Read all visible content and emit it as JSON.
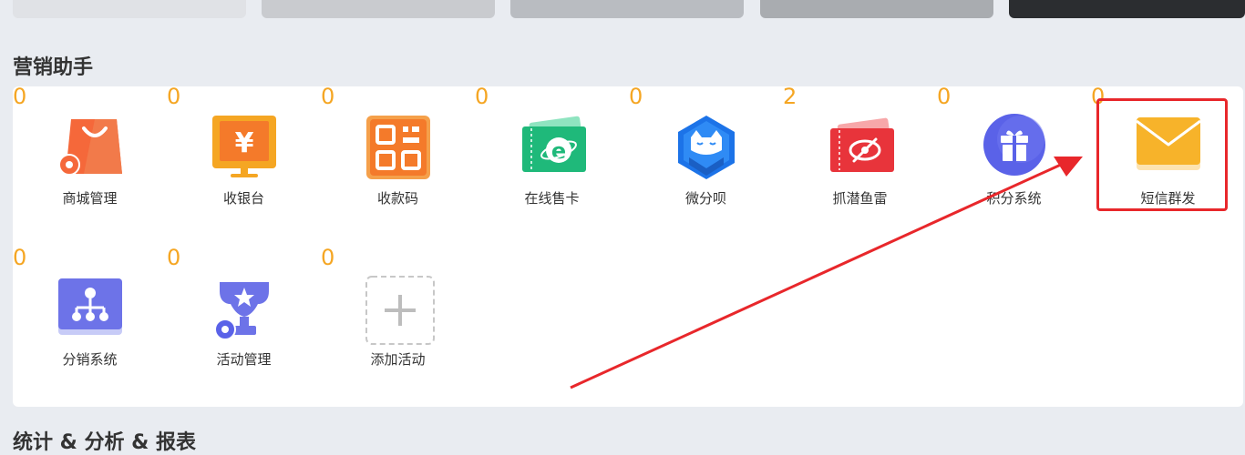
{
  "section": {
    "title": "营销助手"
  },
  "tiles_row1": [
    {
      "count": "0",
      "label": "商城管理",
      "icon": "shop-bag-icon"
    },
    {
      "count": "0",
      "label": "收银台",
      "icon": "cashier-yen-icon"
    },
    {
      "count": "0",
      "label": "收款码",
      "icon": "qr-code-icon"
    },
    {
      "count": "0",
      "label": "在线售卡",
      "icon": "ecard-icon"
    },
    {
      "count": "0",
      "label": "微分呗",
      "icon": "cat-hexagon-icon"
    },
    {
      "count": "2",
      "label": "抓潜鱼雷",
      "icon": "hidden-eye-ticket-icon"
    },
    {
      "count": "0",
      "label": "积分系统",
      "icon": "gift-icon"
    },
    {
      "count": "0",
      "label": "短信群发",
      "icon": "envelope-icon"
    }
  ],
  "tiles_row2": [
    {
      "count": "0",
      "label": "分销系统",
      "icon": "distribution-tree-icon"
    },
    {
      "count": "0",
      "label": "活动管理",
      "icon": "trophy-icon"
    },
    {
      "count": "0",
      "label": "添加活动",
      "icon": "add-plus-icon"
    }
  ],
  "bottom": {
    "title": "统计 & 分析 & 报表"
  },
  "colors": {
    "count": "#f5a623",
    "highlight": "#e8272b",
    "arrow": "#e8272b"
  }
}
